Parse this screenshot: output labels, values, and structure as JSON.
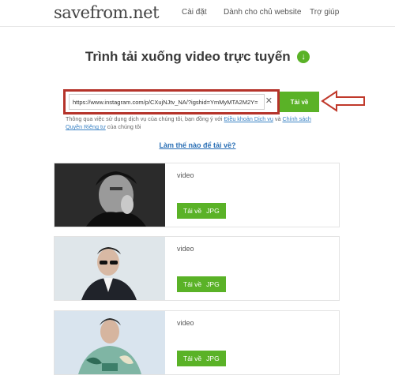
{
  "header": {
    "logo": "savefrom.net",
    "nav": [
      "Cài đặt",
      "Dành cho chủ website",
      "Trợ giúp"
    ]
  },
  "main": {
    "title": "Trình tải xuống video trực tuyến",
    "title_icon": "download-circle-icon",
    "search": {
      "value": "https://www.instagram.com/p/CXujNJtv_NA/?igshid=YmMyMTA2M2Y=",
      "clear_icon": "close-icon",
      "button": "Tải về"
    },
    "terms": {
      "prefix": "Thông qua việc sử dụng dịch vụ của chúng tôi, bạn đồng ý với",
      "link1": "Điều khoản Dịch vụ",
      "middle": "và",
      "link2": "Chính sách Quyền Riêng tư",
      "suffix": "của chúng tôi"
    },
    "howto": "Làm thế nào để tải về?"
  },
  "results": [
    {
      "label": "video",
      "download": "Tải về",
      "format": "JPG"
    },
    {
      "label": "video",
      "download": "Tải về",
      "format": "JPG"
    },
    {
      "label": "video",
      "download": "Tải về",
      "format": "JPG"
    }
  ],
  "colors": {
    "accent_green": "#5ab227",
    "highlight_red": "#b5332a",
    "link_blue": "#2a6fb5"
  }
}
